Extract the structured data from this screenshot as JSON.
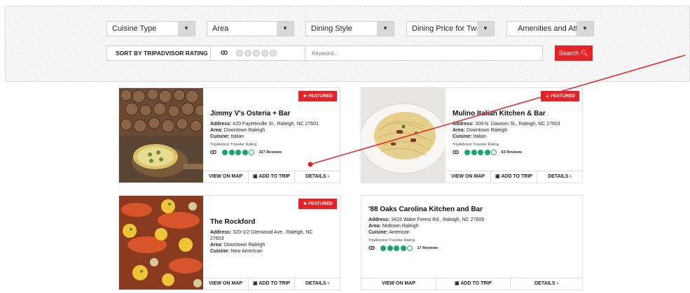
{
  "filters": {
    "cuisine": {
      "value": "Cuisine Type",
      "icon": "chevron-down-icon"
    },
    "area": {
      "value": "Area"
    },
    "dining_style": {
      "value": "Dining Style"
    },
    "price": {
      "value": "Dining Price for Two"
    },
    "amenities": {
      "value": "Amenities and Attribu"
    },
    "sort_label": "SORT BY TRIPADVISOR RATING",
    "keyword_placeholder": "Keyword...",
    "search_label": "Search",
    "search_icon": "magnifier-icon"
  },
  "common": {
    "featured_label": "FEATURED",
    "ta_label": "TripAdvisor Traveler Rating",
    "address_key": "Address:",
    "area_key": "Area:",
    "cuisine_key": "Cuisine:",
    "view_map": "VIEW ON MAP",
    "add_trip": "ADD TO TRIP",
    "details": "DETAILS"
  },
  "restaurants": [
    {
      "name": "Jimmy V's Osteria + Bar",
      "address": "420 Fayetteville St., Raleigh, NC 27601",
      "area": "Downtown Raleigh",
      "cuisine": "Italian",
      "rating": 4,
      "reviews": "327 Reviews",
      "featured": true
    },
    {
      "name": "Mulino Italian Kitchen & Bar",
      "address": "309 N. Dawson St., Raleigh, NC 27603",
      "area": "Downtown Raleigh",
      "cuisine": "Italian",
      "rating": 4,
      "reviews": "63 Reviews",
      "featured": true
    },
    {
      "name": "The Rockford",
      "address_line1": "320-1/2 Glenwood Ave., Raleigh, NC",
      "address_line2": "27603",
      "area": "Downtown Raleigh",
      "cuisine": "New American",
      "featured": true
    },
    {
      "name": "'88 Oaks Carolina Kitchen and Bar",
      "address": "3415 Wake Forest Rd., Raleigh, NC 27609",
      "area": "Midtown Raleigh",
      "cuisine": "American",
      "rating": 4,
      "reviews": "17 Reviews",
      "featured": false
    }
  ],
  "colors": {
    "accent": "#e52326",
    "tripadvisor_green": "#1aa66a",
    "annotation": "#e52326"
  }
}
